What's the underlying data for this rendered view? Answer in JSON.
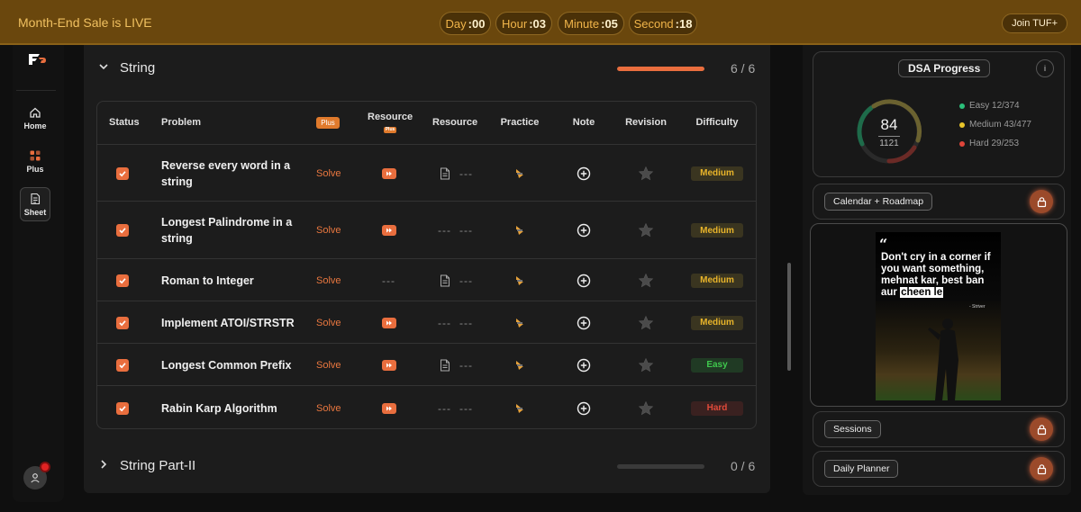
{
  "banner": {
    "text": "Month-End Sale is LIVE",
    "timers": [
      {
        "label": "Day",
        "value": ":00"
      },
      {
        "label": "Hour",
        "value": ":03"
      },
      {
        "label": "Minute",
        "value": ":05"
      },
      {
        "label": "Second",
        "value": ":18"
      }
    ],
    "join_label": "Join TUF+"
  },
  "sidebar": {
    "items": [
      {
        "label": "Home",
        "icon": "home-icon"
      },
      {
        "label": "Plus",
        "icon": "plus-grid-icon"
      },
      {
        "label": "Sheet",
        "icon": "sheet-icon"
      }
    ],
    "active": "Sheet"
  },
  "section": {
    "title": "String",
    "progress_text": "6 / 6",
    "progress_fraction": 1.0
  },
  "table": {
    "headers": {
      "status": "Status",
      "problem": "Problem",
      "plus": "Plus",
      "resource_plus": "Resource",
      "resource_plus_badge": "Plus",
      "resource": "Resource",
      "practice": "Practice",
      "note": "Note",
      "revision": "Revision",
      "difficulty": "Difficulty"
    },
    "solve_label": "Solve",
    "dash": "---",
    "rows": [
      {
        "problem": "Reverse every word in a string",
        "plus_resource": "video",
        "resource": "doc",
        "difficulty": "Medium"
      },
      {
        "problem": "Longest Palindrome in a string",
        "plus_resource": "video",
        "resource": "dash",
        "difficulty": "Medium"
      },
      {
        "problem": "Roman to Integer",
        "plus_resource": "dash",
        "resource": "doc",
        "difficulty": "Medium"
      },
      {
        "problem": "Implement ATOI/STRSTR",
        "plus_resource": "video",
        "resource": "dash",
        "difficulty": "Medium"
      },
      {
        "problem": "Longest Common Prefix",
        "plus_resource": "video",
        "resource": "doc",
        "difficulty": "Easy"
      },
      {
        "problem": "Rabin Karp Algorithm",
        "plus_resource": "video",
        "resource": "dash",
        "difficulty": "Hard"
      }
    ]
  },
  "section2": {
    "title": "String Part-II",
    "progress_text": "0 / 6",
    "progress_fraction": 0.0
  },
  "dsa": {
    "title": "DSA Progress",
    "info": "i",
    "solved": "84",
    "total": "1121",
    "legend": [
      {
        "label": "Easy",
        "value": "12/374",
        "color": "#2bbf7a"
      },
      {
        "label": "Medium",
        "value": "43/477",
        "color": "#e8c42a"
      },
      {
        "label": "Hard",
        "value": "29/253",
        "color": "#e0453a"
      }
    ]
  },
  "right_cards": {
    "calendar": "Calendar + Roadmap",
    "sessions": "Sessions",
    "planner": "Daily Planner"
  },
  "quote": {
    "mark": "“",
    "line1": "Don't cry in a corner if you want something, mehnat kar, best ban aur",
    "highlight": "cheen le",
    "signature": "- Striver"
  },
  "colors": {
    "accent": "#e96e3e",
    "banner": "#6a470d"
  }
}
